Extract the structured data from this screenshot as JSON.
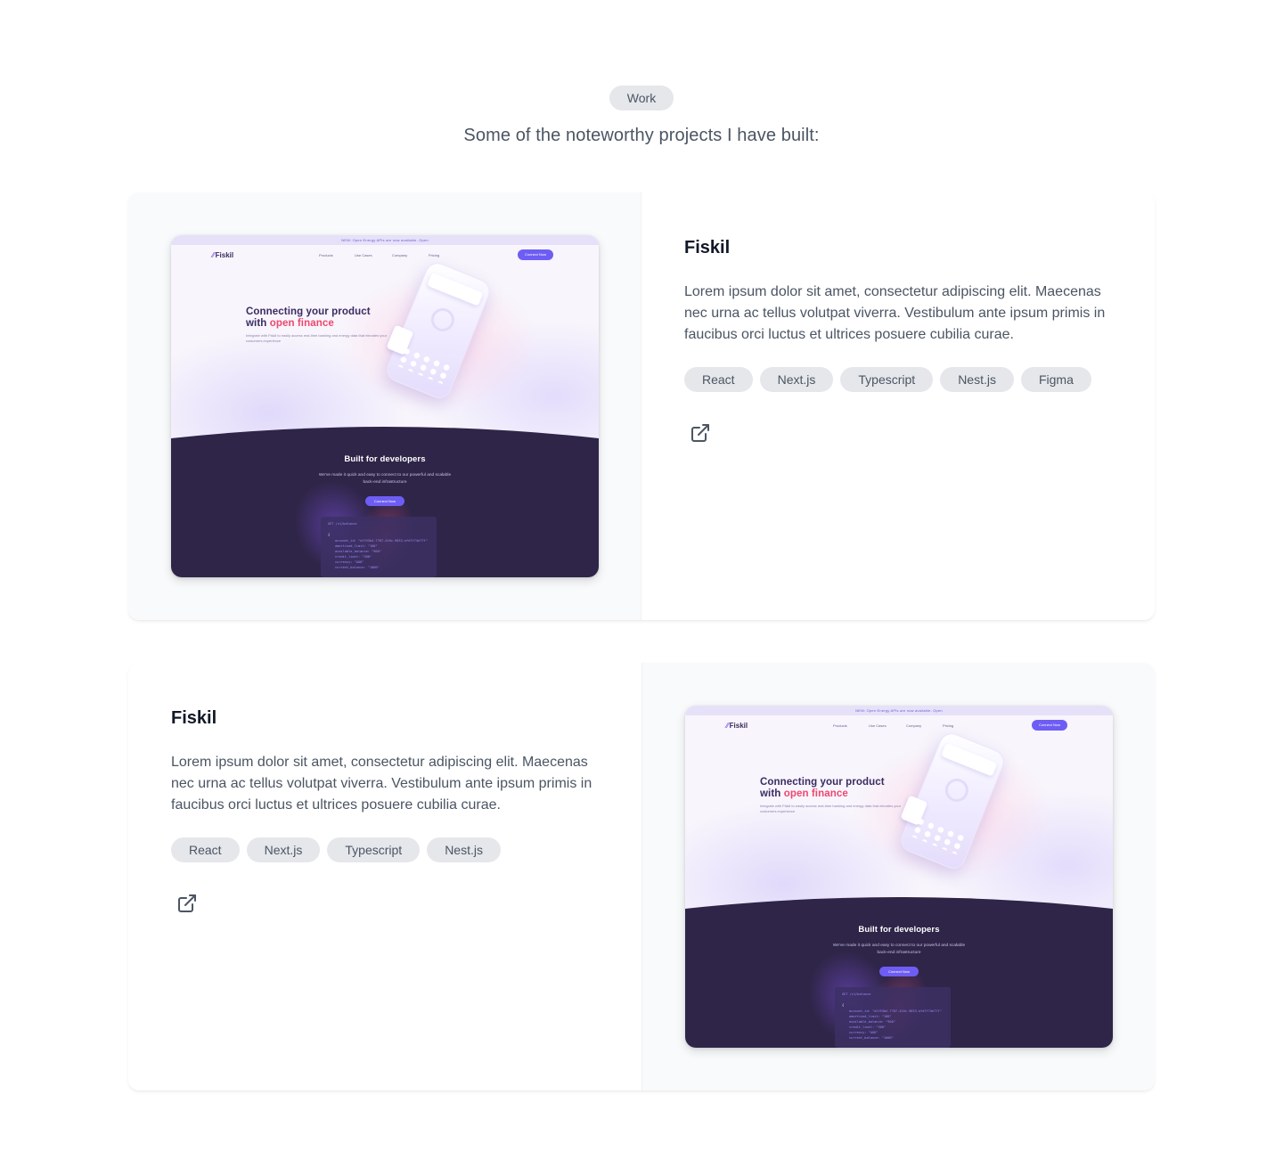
{
  "section": {
    "badge": "Work",
    "subtitle": "Some of the noteworthy projects I have built:"
  },
  "preview": {
    "banner": "NEW: Open Energy APIs are now available. Open",
    "logo": "Fiskil",
    "nav": [
      "Products",
      "Use Cases",
      "Company",
      "Pricing"
    ],
    "nav_button": "Connect Now",
    "hero_line1": "Connecting your product",
    "hero_line2_prefix": "with",
    "hero_accent": "open finance",
    "hero_sub": "Integrate with Fiskil to easily access real-time banking and energy data that elevates your customers experience",
    "dev_title": "Built for developers",
    "dev_sub": "We've made it quick and easy to connect to our powerful and scalable back-end infrastructure",
    "dev_button": "Connect Now",
    "code_header": "GET /v1/balance",
    "code_lines": [
      "{",
      "account_id: \"e2f53b4-7707-416c-9833-efd7f74e77f\"",
      "amortised_limit: \"100\"",
      "available_balance: \"900\"",
      "credit_limit: \"300\"",
      "currency: \"AUD\"",
      "current_balance: \"1000\""
    ]
  },
  "projects": [
    {
      "title": "Fiskil",
      "description": "Lorem ipsum dolor sit amet, consectetur adipiscing elit. Maecenas nec urna ac tellus volutpat viverra. Vestibulum ante ipsum primis in faucibus orci luctus et ultrices posuere cubilia curae.",
      "tags": [
        "React",
        "Next.js",
        "Typescript",
        "Nest.js",
        "Figma"
      ],
      "link_icon": "external-link-icon"
    },
    {
      "title": "Fiskil",
      "description": "Lorem ipsum dolor sit amet, consectetur adipiscing elit. Maecenas nec urna ac tellus volutpat viverra. Vestibulum ante ipsum primis in faucibus orci luctus et ultrices posuere cubilia curae.",
      "tags": [
        "React",
        "Next.js",
        "Typescript",
        "Nest.js"
      ],
      "link_icon": "external-link-icon"
    }
  ],
  "colors": {
    "badge_bg": "#e5e7eb",
    "title": "#111827",
    "text": "#4b5563",
    "preview_dark": "#2f2548",
    "preview_accent": "#6e5df4",
    "preview_highlight": "#ef476f"
  }
}
